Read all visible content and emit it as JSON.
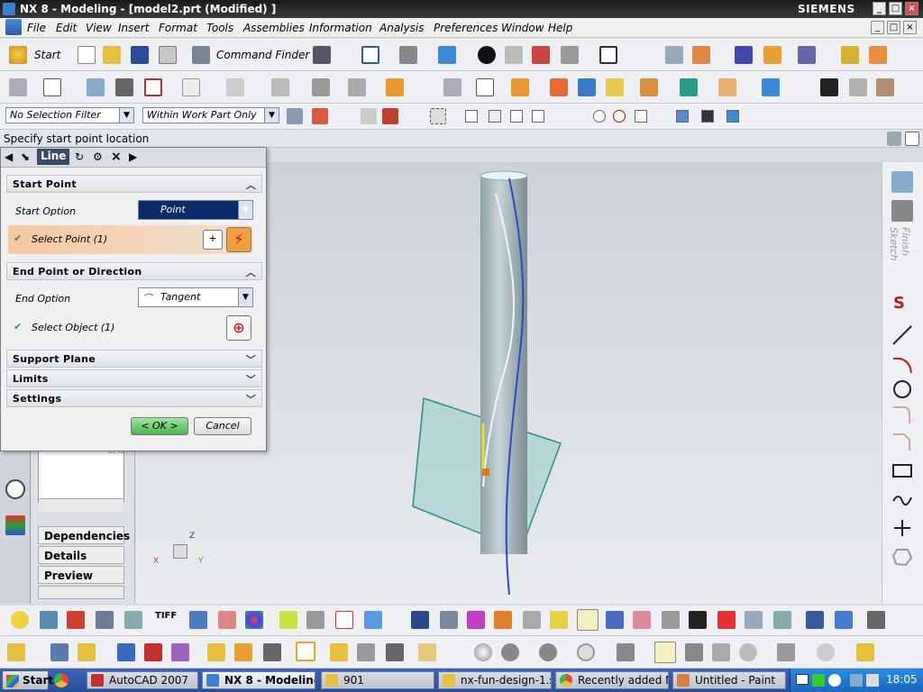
{
  "window": {
    "title": "NX 8 - Modeling - [model2.prt (Modified) ]",
    "brand": "SIEMENS"
  },
  "menu": [
    "File",
    "Edit",
    "View",
    "Insert",
    "Format",
    "Tools",
    "Assemblies",
    "Information",
    "Analysis",
    "Preferences",
    "Window",
    "Help"
  ],
  "toolbar": {
    "start_label": "Start",
    "command_finder_label": "Command Finder"
  },
  "filters": {
    "selection_filter": "No Selection Filter",
    "scope": "Within Work Part Only"
  },
  "cue_line": "Specify start point location",
  "dialog": {
    "title": "Line",
    "start_point": {
      "header": "Start Point",
      "option_label": "Start Option",
      "option_value": "Point",
      "select_label": "Select Point (1)"
    },
    "end_point": {
      "header": "End Point or Direction",
      "option_label": "End Option",
      "option_value": "Tangent",
      "select_label": "Select Object (1)"
    },
    "collapsed_sections": [
      "Support Plane",
      "Limits",
      "Settings"
    ],
    "ok_label": "< OK >",
    "cancel_label": "Cancel"
  },
  "navigator": {
    "truncated_item": "Chu",
    "panels": [
      "Dependencies",
      "Details",
      "Preview"
    ]
  },
  "right_bar": {
    "finish_sketch": "Finish Sketch"
  },
  "triad": {
    "x": "X",
    "y": "Y",
    "z": "Z"
  },
  "taskbar": {
    "start_label": "Start",
    "tasks": [
      "AutoCAD 2007",
      "NX 8 - Modeling ...",
      "901",
      "nx-fun-design-1.s...",
      "Recently added N...",
      "Untitled - Paint"
    ],
    "clock": "18:05"
  },
  "colors": {
    "accent_title": "#1a1a1a",
    "dialog_ok_green": "#5fc85f",
    "taskbar_blue": "#2a4e9c"
  }
}
